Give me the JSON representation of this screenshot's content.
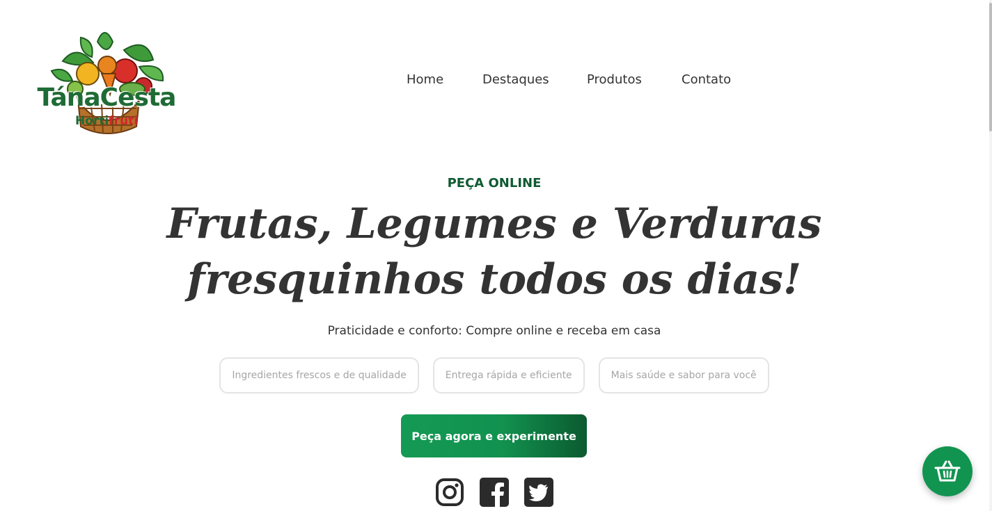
{
  "logo": {
    "title": "TánaCesta",
    "subtitle_part1": "Horti",
    "subtitle_part2": "fruti"
  },
  "nav": {
    "items": [
      {
        "label": "Home"
      },
      {
        "label": "Destaques"
      },
      {
        "label": "Produtos"
      },
      {
        "label": "Contato"
      }
    ]
  },
  "hero": {
    "kicker": "PEÇA ONLINE",
    "headline_line1": "Frutas, Legumes e Verduras",
    "headline_line2": "fresquinhos todos os dias!",
    "lead": "Praticidade e conforto: Compre online e receba em casa",
    "chips": [
      {
        "label": "Ingredientes frescos e de qualidade"
      },
      {
        "label": "Entrega rápida e eficiente"
      },
      {
        "label": "Mais saúde e sabor para você"
      }
    ],
    "cta_label": "Peça agora e experimente"
  },
  "social": [
    {
      "icon": "instagram-icon"
    },
    {
      "icon": "facebook-icon"
    },
    {
      "icon": "twitter-icon"
    }
  ],
  "cart": {
    "icon": "basket-icon"
  },
  "colors": {
    "brand_green": "#149a55",
    "dark_green": "#0b5a30",
    "kicker_green": "#0f5a32",
    "text": "#333333",
    "chip_text": "#a6a6a6"
  }
}
